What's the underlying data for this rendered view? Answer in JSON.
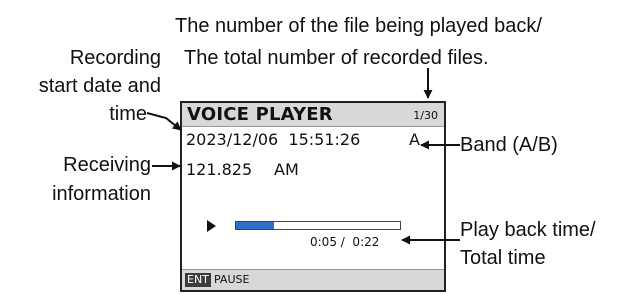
{
  "callouts": {
    "file_number_line1": "The number of the file being played back/",
    "file_number_line2": "The total number of recorded files.",
    "recording_start_line1": "Recording",
    "recording_start_line2": "start date and",
    "recording_start_line3": "time",
    "receiving_line1": "Receiving",
    "receiving_line2": "information",
    "band": "Band (A/B)",
    "playback_line1": "Play back time/",
    "playback_line2": "Total time"
  },
  "screen": {
    "title": "VOICE PLAYER",
    "file_count": "1/30",
    "date_time": "2023/12/06  15:51:26",
    "band": "A",
    "frequency": "121.825",
    "mode": "AM",
    "time_readout": "0:05 /  0:22",
    "progress": 0.23,
    "footer_key": "ENT",
    "footer_action": "PAUSE",
    "progress_color": "#2f6ec8"
  },
  "icons": {
    "play": "play-icon"
  }
}
